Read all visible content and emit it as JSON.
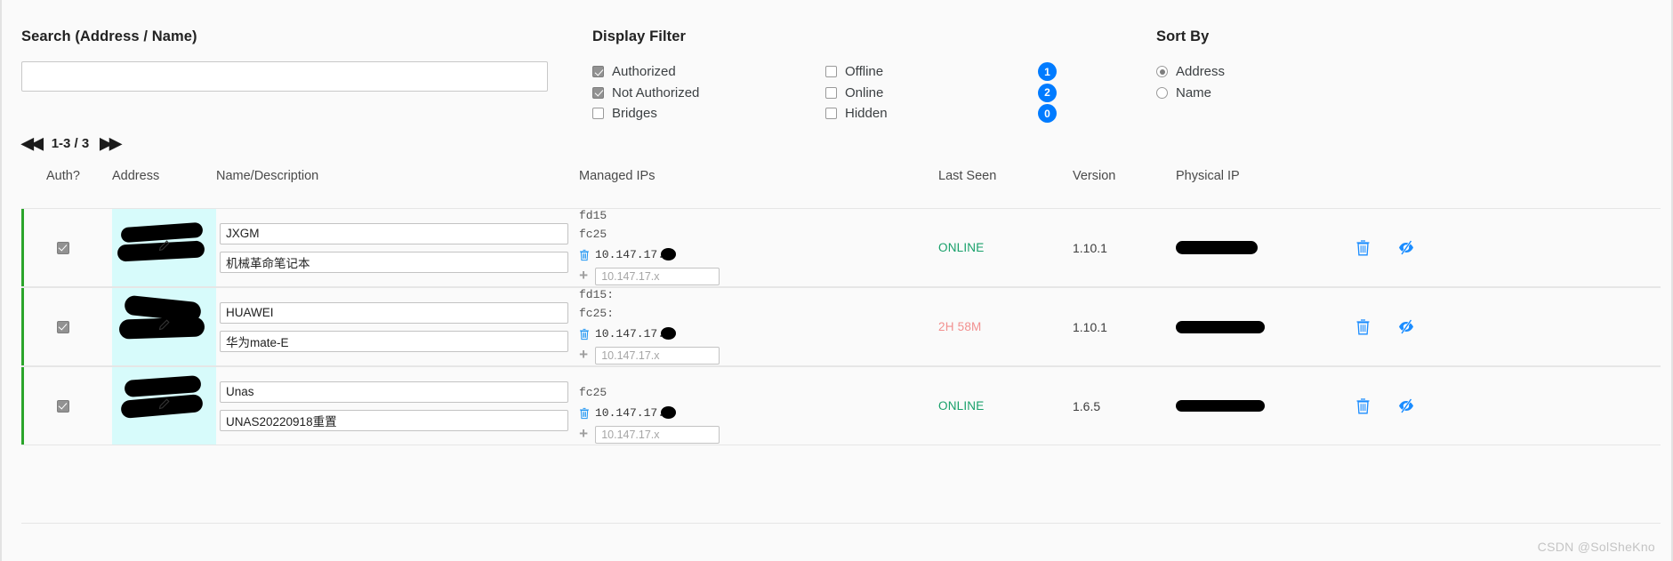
{
  "search": {
    "label": "Search (Address / Name)",
    "value": "",
    "placeholder": ""
  },
  "display_filter": {
    "title": "Display Filter",
    "left_items": [
      {
        "label": "Authorized",
        "checked": true
      },
      {
        "label": "Not Authorized",
        "checked": true
      },
      {
        "label": "Bridges",
        "checked": false
      }
    ],
    "right_items": [
      {
        "label": "Offline",
        "checked": false,
        "badge": "1"
      },
      {
        "label": "Online",
        "checked": false,
        "badge": "2"
      },
      {
        "label": "Hidden",
        "checked": false,
        "badge": "0"
      }
    ]
  },
  "sort_by": {
    "title": "Sort By",
    "options": [
      {
        "label": "Address",
        "selected": true
      },
      {
        "label": "Name",
        "selected": false
      }
    ]
  },
  "pagination": {
    "first_label": "◀◀",
    "range": "1-3 / 3",
    "last_label": "▶▶"
  },
  "table": {
    "headers": {
      "auth": "Auth?",
      "address": "Address",
      "name": "Name/Description",
      "managed_ips": "Managed IPs",
      "last_seen": "Last Seen",
      "version": "Version",
      "physical_ip": "Physical IP"
    },
    "rows": [
      {
        "auth_checked": true,
        "name": "JXGM",
        "description": "机械革命笔记本",
        "ipv6_a": "fd15",
        "ipv6_b": "fc25",
        "managed_ip": "10.147.17.",
        "ip_placeholder": "10.147.17.x",
        "last_seen": "ONLINE",
        "last_seen_state": "online",
        "version": "1.10.1"
      },
      {
        "auth_checked": true,
        "name": "HUAWEI",
        "description": "华为mate-E",
        "ipv6_a": "fd15:",
        "ipv6_b": "fc25:",
        "managed_ip": "10.147.17.",
        "ip_placeholder": "10.147.17.x",
        "last_seen": "2H 58M",
        "last_seen_state": "stale",
        "version": "1.10.1"
      },
      {
        "auth_checked": true,
        "name": "Unas",
        "description": "UNAS20220918重置",
        "ipv6_a": "",
        "ipv6_b": "fc25",
        "managed_ip": "10.147.17.",
        "ip_placeholder": "10.147.17.x",
        "last_seen": "ONLINE",
        "last_seen_state": "online",
        "version": "1.6.5"
      }
    ],
    "row_actions": {
      "delete": "delete-member",
      "hide": "hide-member"
    }
  },
  "watermark": "CSDN @SolSheKno",
  "colors": {
    "badge": "#007bff",
    "online": "#18a06a",
    "stale": "#f2908f",
    "row_accent": "#2aa52a",
    "address_highlight": "#d7fbfb",
    "action_icon": "#1a8cff"
  }
}
